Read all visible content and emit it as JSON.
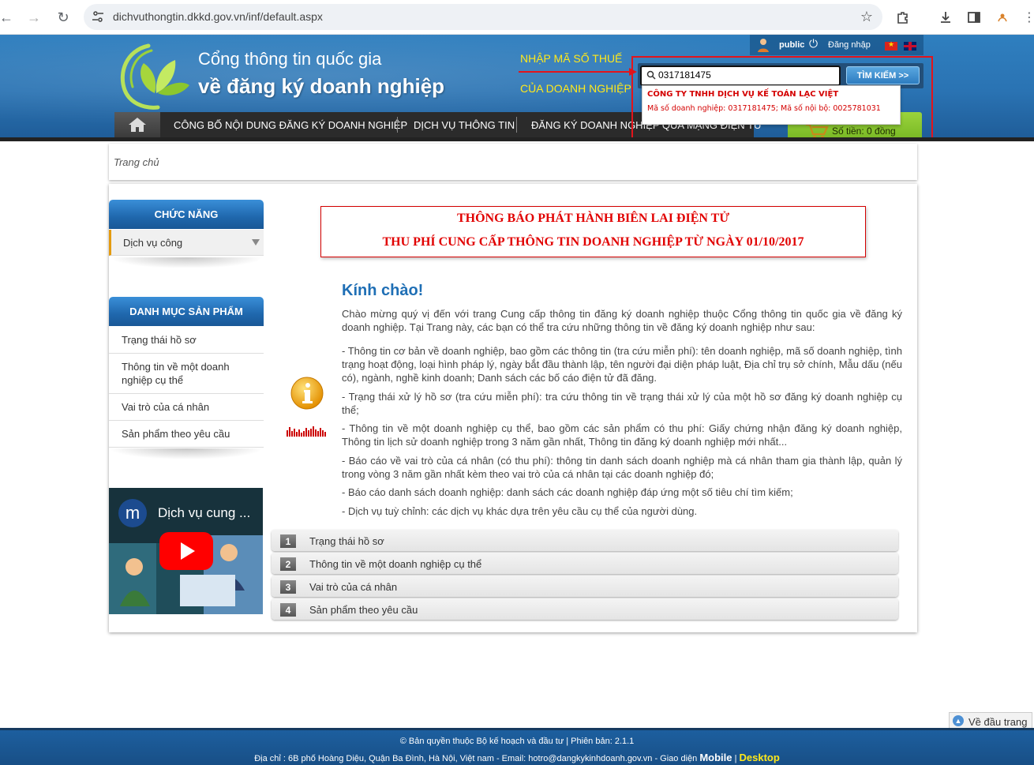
{
  "browser": {
    "url": "dichvuthongtin.dkkd.gov.vn/inf/default.aspx"
  },
  "header": {
    "title_line1": "Cổng thông tin quốc gia",
    "title_line2": "về đăng ký doanh nghiệp",
    "hint_line1": "NHẬP MÃ SỐ THUẾ",
    "hint_line2": "CỦA DOANH NGHIỆP",
    "user": "public",
    "login": "Đăng nhập",
    "search_value": "0317181475",
    "search_button": "TÌM KIẾM >>",
    "cart_label": "Số tiền: 0 đồng",
    "menu": [
      "CÔNG BỐ NỘI DUNG ĐĂNG KÝ DOANH NGHIỆP",
      "DỊCH VỤ THÔNG TIN",
      "ĐĂNG KÝ DOANH NGHIỆP QUA MẠNG ĐIỆN TỬ"
    ],
    "suggestion": {
      "name": "CÔNG TY TNHH DỊCH VỤ KẾ TOÁN LẠC VIỆT",
      "detail": "Mã số doanh nghiệp: 0317181475; Mã số nội bộ: 0025781031"
    }
  },
  "breadcrumb": "Trang chủ",
  "sidebar": {
    "functions_title": "CHỨC NĂNG",
    "functions_selected": "Dịch vụ công",
    "products_title": "DANH MỤC SẢN PHẨM",
    "products": [
      "Trạng thái hồ sơ",
      "Thông tin về một doanh nghiệp cụ thể",
      "Vai trò của cá nhân",
      "Sản phẩm theo yêu cầu"
    ],
    "video_title": "Dịch vụ cung ...",
    "video_logo": "m"
  },
  "notice": {
    "line1": "THÔNG BÁO PHÁT HÀNH BIÊN LAI ĐIỆN TỬ",
    "line2": "THU PHÍ CUNG CẤP THÔNG TIN DOANH NGHIỆP TỪ NGÀY 01/10/2017"
  },
  "content": {
    "greeting": "Kính chào!",
    "intro": "Chào mừng quý vị đến với trang Cung cấp thông tin đăng ký doanh nghiệp thuộc Cổng thông tin quốc gia về đăng ký doanh nghiệp. Tại Trang này, các bạn có thể tra cứu những thông tin về đăng ký doanh nghiệp như sau:",
    "bullets": [
      "- Thông tin cơ bản về doanh nghiệp, bao gồm các thông tin (tra cứu miễn phí): tên doanh nghiệp, mã số doanh nghiệp, tình trạng hoạt động, loại hình pháp lý, ngày bắt đầu thành lập, tên người đại diện pháp luật, Địa chỉ trụ sở chính, Mẫu dấu (nếu có), ngành, nghề kinh doanh; Danh sách các bố cáo điện tử đã đăng.",
      "- Trạng thái xử lý hồ sơ (tra cứu miễn phí): tra cứu thông tin về trạng thái xử lý của một hồ sơ đăng ký doanh nghiệp cụ thể;",
      "- Thông tin về một doanh nghiệp cụ thể, bao gồm các sản phẩm có thu phí: Giấy chứng nhận đăng ký doanh nghiệp, Thông tin lịch sử doanh nghiệp trong 3 năm gần nhất, Thông tin đăng ký doanh nghiệp mới nhất...",
      "- Báo cáo về vai trò của cá nhân (có thu phí): thông tin danh sách doanh nghiệp mà cá nhân tham gia thành lập, quản lý trong vòng 3 năm gần nhất kèm theo vai trò của cá nhân tại các doanh nghiệp đó;",
      "- Báo cáo danh sách doanh nghiệp: danh sách các doanh nghiệp đáp ứng một số tiêu chí tìm kiếm;",
      "- Dịch vụ tuỳ chỉnh: các dịch vụ khác dựa trên yêu cầu cụ thể của người dùng."
    ],
    "steps": [
      {
        "num": "1",
        "label": "Trạng thái hồ sơ"
      },
      {
        "num": "2",
        "label": "Thông tin về một doanh nghiệp cụ thể"
      },
      {
        "num": "3",
        "label": "Vai trò của cá nhân"
      },
      {
        "num": "4",
        "label": "Sản phẩm theo yêu cầu"
      }
    ]
  },
  "back_to_top": "Về đầu trang",
  "footer": {
    "line1": "© Bản quyền thuộc Bộ kế hoạch và đầu tư | Phiên bản: 2.1.1",
    "line2_prefix": "Địa chỉ : 6B phố Hoàng Diệu, Quận Ba Đình, Hà Nội, Việt nam - Email: hotro@dangkykinhdoanh.gov.vn - Giao diện ",
    "mobile": "Mobile",
    "separator": " | ",
    "desktop": "Desktop"
  },
  "colors": {
    "header_blue": "#2a73b3",
    "accent_yellow": "#ffe81a",
    "notice_red": "#e10000",
    "cart_green": "#7ec22a"
  }
}
